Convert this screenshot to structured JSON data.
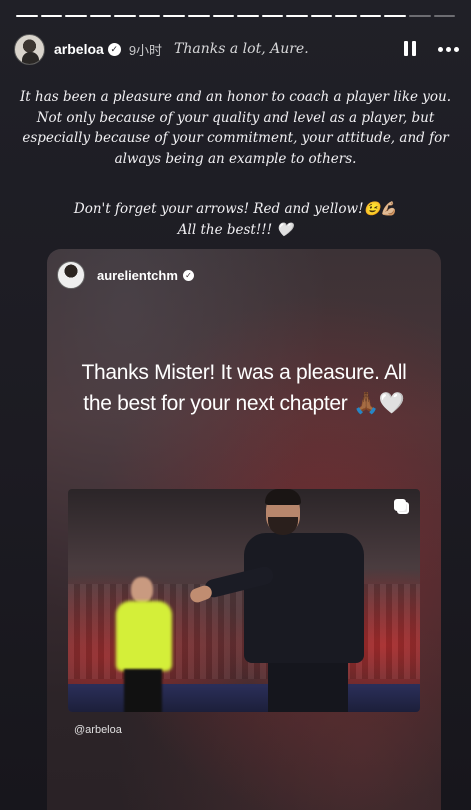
{
  "progress": {
    "total_segments": 18,
    "completed_segments": 16
  },
  "header": {
    "username": "arbeloa",
    "time": "9小时",
    "caption": "Thanks a lot, Aure."
  },
  "story": {
    "paragraph1": [
      "It has been a pleasure and an honor to coach a player like you.",
      "Not only because of your quality and level as a player, but",
      "especially because of your commitment, your attitude, and for",
      "always being an example to others."
    ],
    "paragraph2_line1": "Don't forget your arrows! Red and yellow!😉💪🏼",
    "paragraph2_line2": "All the best!!! 🤍"
  },
  "card": {
    "username": "aurelientchm",
    "quote_line1": "Thanks Mister! It was a pleasure. All",
    "quote_line2": "the best for your next chapter 🙏🏾🤍",
    "mention": "@arbeloa"
  },
  "icons": {
    "verified": "verified-badge-icon",
    "pause": "pause-icon",
    "more": "more-options-icon",
    "multi": "multiple-media-icon"
  }
}
